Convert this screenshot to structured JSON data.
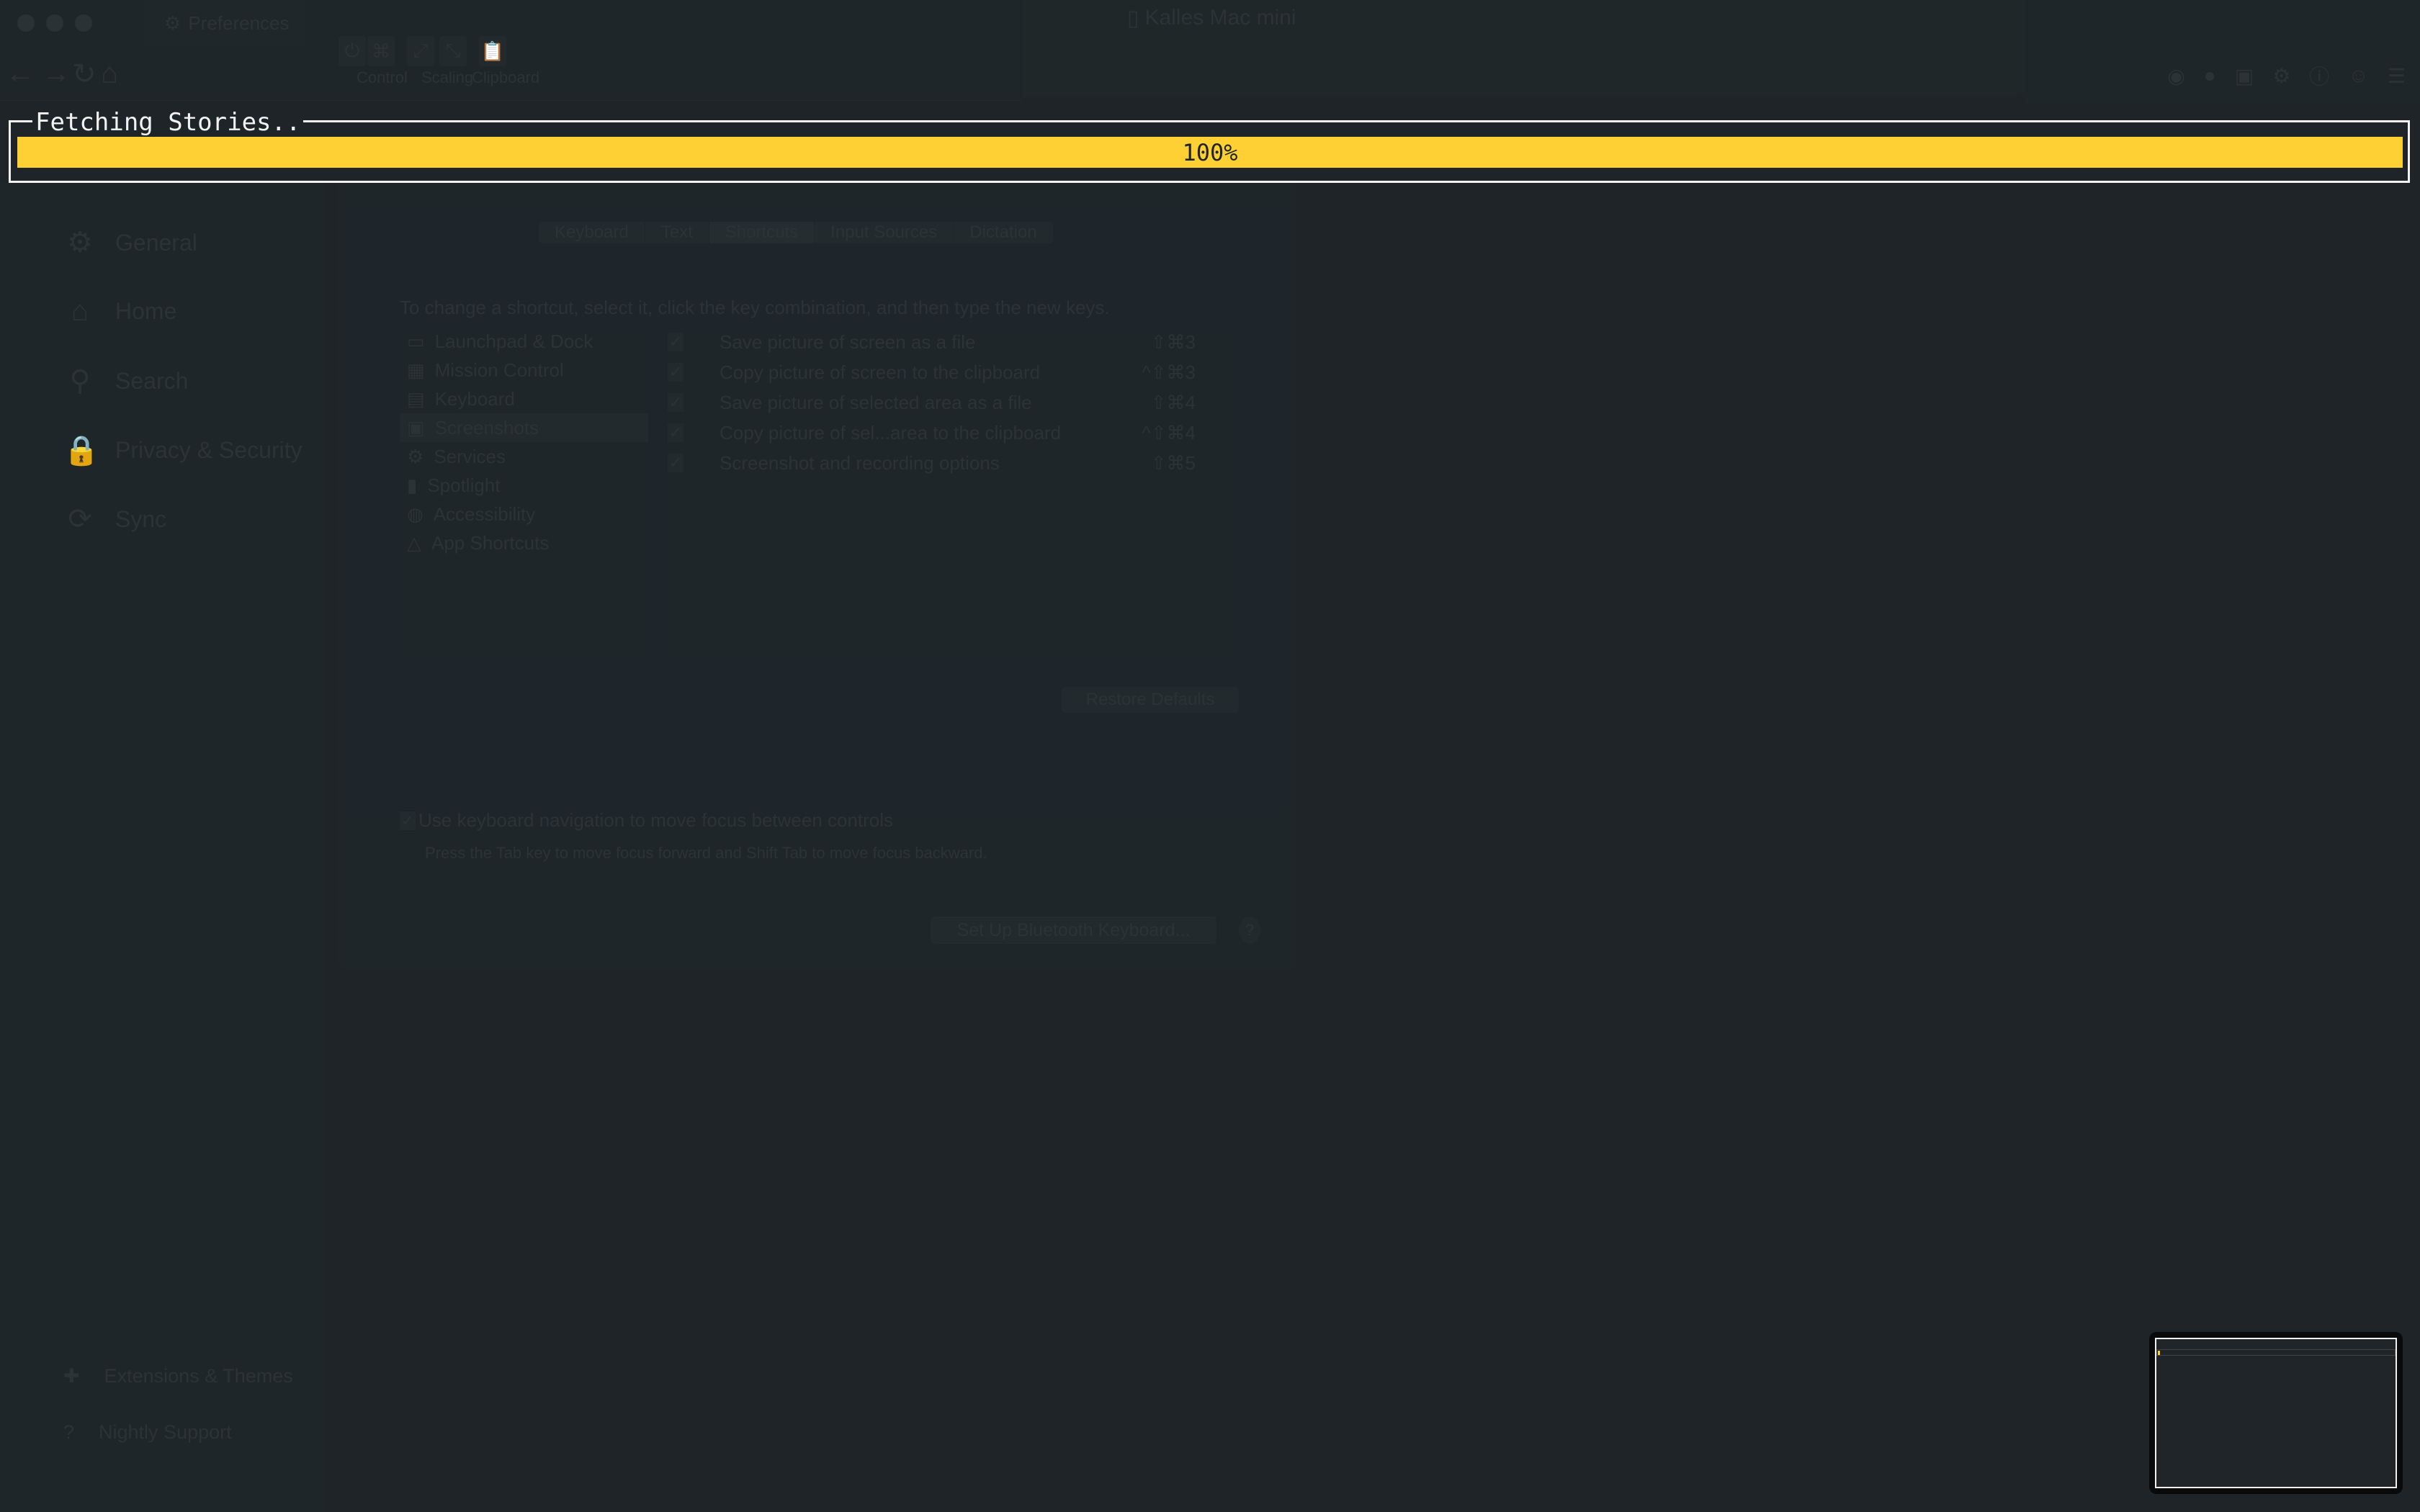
{
  "window": {
    "tab_title": "Preferences",
    "remote_title": "Kalles Mac mini"
  },
  "toolbar": {
    "groups": [
      "Control",
      "Scaling",
      "Clipboard"
    ]
  },
  "overlay": {
    "title": "Fetching Stories..",
    "progress_percent": 100,
    "progress_label": "100%",
    "bar_color": "#ffd033"
  },
  "sidebar": {
    "items": [
      {
        "label": "General",
        "icon": "gear-icon"
      },
      {
        "label": "Home",
        "icon": "home-icon"
      },
      {
        "label": "Search",
        "icon": "search-icon"
      },
      {
        "label": "Privacy & Security",
        "icon": "lock-icon"
      },
      {
        "label": "Sync",
        "icon": "sync-icon"
      }
    ],
    "footer": [
      {
        "label": "Extensions & Themes",
        "icon": "puzzle-icon"
      },
      {
        "label": "Nightly Support",
        "icon": "help-circle-icon"
      }
    ]
  },
  "dialog": {
    "tabs": [
      "Keyboard",
      "Text",
      "Shortcuts",
      "Input Sources",
      "Dictation"
    ],
    "selected_tab": "Shortcuts",
    "instruction": "To change a shortcut, select it, click the key combination, and then type the new keys.",
    "categories": [
      "Launchpad & Dock",
      "Mission Control",
      "Keyboard",
      "Screenshots",
      "Services",
      "Spotlight",
      "Accessibility",
      "App Shortcuts"
    ],
    "selected_category": "Screenshots",
    "shortcuts": [
      {
        "label": "Save picture of screen as a file",
        "keys": "⇧⌘3",
        "checked": true
      },
      {
        "label": "Copy picture of screen to the clipboard",
        "keys": "^⇧⌘3",
        "checked": true
      },
      {
        "label": "Save picture of selected area as a file",
        "keys": "⇧⌘4",
        "checked": true
      },
      {
        "label": "Copy picture of sel...area to the clipboard",
        "keys": "^⇧⌘4",
        "checked": true
      },
      {
        "label": "Screenshot and recording options",
        "keys": "⇧⌘5",
        "checked": true
      }
    ],
    "restore_label": "Restore Defaults",
    "kbnav_label": "Use keyboard navigation to move focus between controls",
    "kbnav_checked": true,
    "kbnav_desc": "Press the Tab key to move focus forward and Shift Tab to move focus backward.",
    "bluetooth_label": "Set Up Bluetooth Keyboard...",
    "help_label": "?"
  }
}
